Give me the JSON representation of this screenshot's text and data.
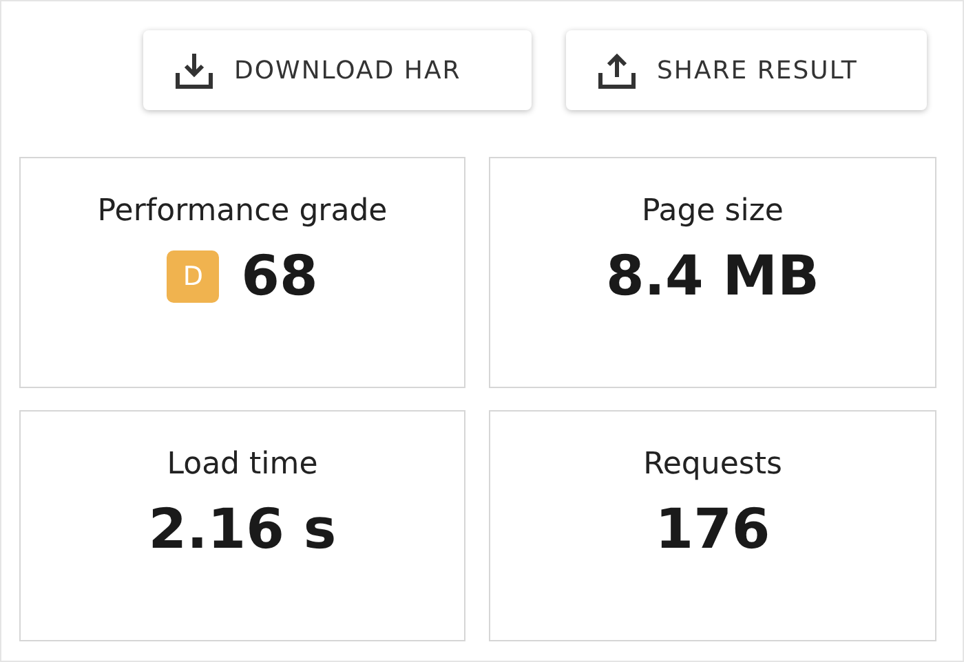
{
  "actions": [
    {
      "label": "DOWNLOAD HAR",
      "kind": "download"
    },
    {
      "label": "SHARE RESULT",
      "kind": "share"
    }
  ],
  "metrics": [
    {
      "label": "Performance grade",
      "value": "68",
      "grade": {
        "letter": "D",
        "color": "#f0b34f"
      }
    },
    {
      "label": "Page size",
      "value": "8.4 MB"
    },
    {
      "label": "Load time",
      "value": "2.16 s"
    },
    {
      "label": "Requests",
      "value": "176"
    }
  ]
}
